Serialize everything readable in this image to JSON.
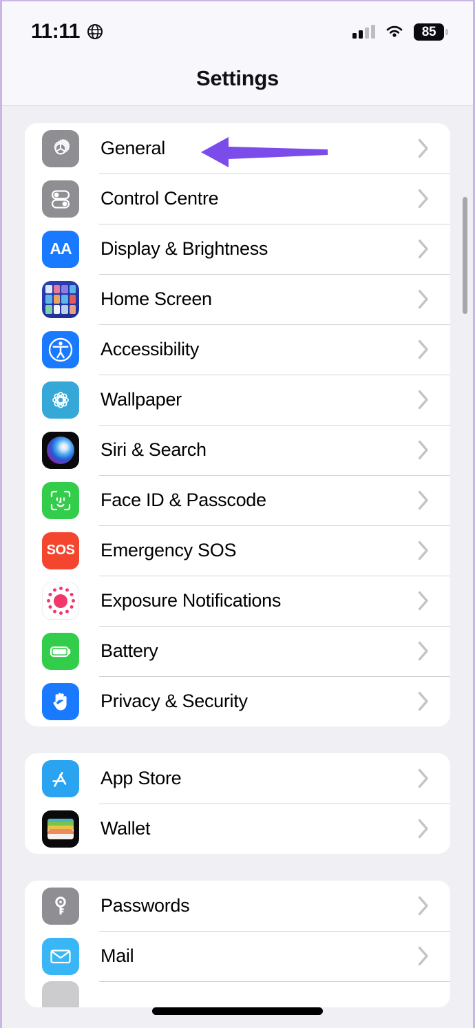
{
  "status_bar": {
    "time": "11:11",
    "location_icon": "globe-icon",
    "cellular_icon": "cellular-signal-icon",
    "wifi_icon": "wifi-icon",
    "battery_level": "85",
    "battery_icon": "battery-icon"
  },
  "header": {
    "title": "Settings"
  },
  "annotation": {
    "type": "arrow",
    "points_to": "General",
    "color": "#7c4ceb",
    "direction": "left"
  },
  "colors": {
    "page_background": "#f0f0f4",
    "card_background": "#ffffff",
    "separator": "#d2d2d6",
    "chevron": "#c3c3c8",
    "accent_purple": "#7c4ceb"
  },
  "groups": [
    {
      "id": "group-system",
      "rows": [
        {
          "label": "General",
          "icon": "gear-icon",
          "icon_style": "gray",
          "chevron": true
        },
        {
          "label": "Control Centre",
          "icon": "control-centre-icon",
          "icon_style": "gray",
          "chevron": true
        },
        {
          "label": "Display & Brightness",
          "icon": "display-brightness-icon",
          "icon_style": "blue",
          "chevron": true
        },
        {
          "label": "Home Screen",
          "icon": "home-screen-icon",
          "icon_style": "dark-blue",
          "chevron": true
        },
        {
          "label": "Accessibility",
          "icon": "accessibility-icon",
          "icon_style": "blue",
          "chevron": true
        },
        {
          "label": "Wallpaper",
          "icon": "wallpaper-icon",
          "icon_style": "cyan",
          "chevron": true
        },
        {
          "label": "Siri & Search",
          "icon": "siri-icon",
          "icon_style": "black",
          "chevron": true
        },
        {
          "label": "Face ID & Passcode",
          "icon": "face-id-icon",
          "icon_style": "green",
          "chevron": true
        },
        {
          "label": "Emergency SOS",
          "icon": "emergency-sos-icon",
          "icon_style": "red",
          "chevron": true
        },
        {
          "label": "Exposure Notifications",
          "icon": "exposure-notifications-icon",
          "icon_style": "white",
          "chevron": true
        },
        {
          "label": "Battery",
          "icon": "battery-settings-icon",
          "icon_style": "green",
          "chevron": true
        },
        {
          "label": "Privacy & Security",
          "icon": "privacy-security-icon",
          "icon_style": "blue",
          "chevron": true
        }
      ]
    },
    {
      "id": "group-store",
      "rows": [
        {
          "label": "App Store",
          "icon": "app-store-icon",
          "icon_style": "sky-blue",
          "chevron": true
        },
        {
          "label": "Wallet",
          "icon": "wallet-icon",
          "icon_style": "black",
          "chevron": true
        }
      ]
    },
    {
      "id": "group-accounts",
      "rows": [
        {
          "label": "Passwords",
          "icon": "passwords-key-icon",
          "icon_style": "gray",
          "chevron": true
        },
        {
          "label": "Mail",
          "icon": "mail-icon",
          "icon_style": "light-blue",
          "chevron": true
        },
        {
          "label": "",
          "icon": "partial-icon",
          "icon_style": "gray",
          "chevron": false
        }
      ]
    }
  ],
  "labels": {
    "l_general": "General",
    "l_control_centre": "Control Centre",
    "l_display": "Display & Brightness",
    "l_home_screen": "Home Screen",
    "l_accessibility": "Accessibility",
    "l_wallpaper": "Wallpaper",
    "l_siri": "Siri & Search",
    "l_faceid": "Face ID & Passcode",
    "l_sos": "Emergency SOS",
    "l_exposure": "Exposure Notifications",
    "l_battery": "Battery",
    "l_privacy": "Privacy & Security",
    "l_appstore": "App Store",
    "l_wallet": "Wallet",
    "l_passwords": "Passwords",
    "l_mail": "Mail",
    "aa_glyph": "AA",
    "sos_glyph": "SOS"
  }
}
